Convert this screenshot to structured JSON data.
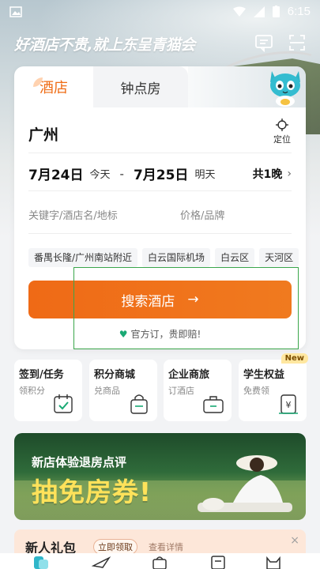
{
  "status_bar": {
    "time": "6:15",
    "icons": [
      "image-icon",
      "wifi-icon",
      "signal-icon",
      "battery-icon"
    ]
  },
  "header": {
    "title": "好酒店不贵,就上东呈青猫会",
    "icons": [
      "message-icon",
      "scan-icon"
    ]
  },
  "booking": {
    "tabs": [
      {
        "label": "酒店",
        "active": true
      },
      {
        "label": "钟点房",
        "active": false
      }
    ],
    "city": "广州",
    "locate_label": "定位",
    "checkin_date": "7月24日",
    "checkin_weekday": "今天",
    "separator": "-",
    "checkout_date": "7月25日",
    "checkout_weekday": "明天",
    "nights": "共1晚",
    "keyword_placeholder": "关键字/酒店名/地标",
    "price_placeholder": "价格/品牌",
    "tags": [
      "番禺长隆/广州南站附近",
      "白云国际机场",
      "白云区",
      "天河区"
    ],
    "search_button": "搜索酒店",
    "search_arrow": "→",
    "guarantee": "官方订，贵即赔!"
  },
  "quick_links": [
    {
      "title": "签到/任务",
      "sub": "领积分",
      "icon": "calendar-check-icon"
    },
    {
      "title": "积分商城",
      "sub": "兑商品",
      "icon": "shopping-bag-icon"
    },
    {
      "title": "企业商旅",
      "sub": "订酒店",
      "icon": "briefcase-icon"
    },
    {
      "title": "学生权益",
      "sub": "免费领",
      "icon": "yen-card-icon",
      "badge": "New"
    }
  ],
  "banner": {
    "line1": "新店体验退房点评",
    "line2": "抽免房券!"
  },
  "promo": {
    "title": "新人礼包",
    "button": "立即领取",
    "note": "查看详情",
    "close": "×"
  },
  "colors": {
    "accent": "#ef6c15",
    "brand_green": "#19a974",
    "highlight_box": "#3aa64b"
  }
}
